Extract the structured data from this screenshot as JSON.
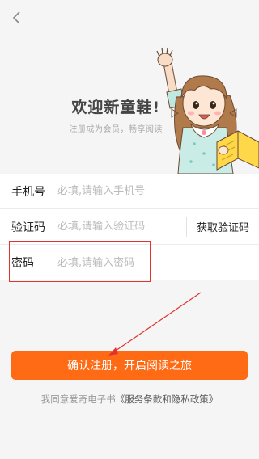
{
  "header": {
    "back_icon": "chevron-left-icon"
  },
  "hero": {
    "title": "欢迎新童鞋!",
    "subtitle": "注册成为会员，畅享阅读"
  },
  "form": {
    "phone": {
      "label": "手机号",
      "placeholder": "必填,请输入手机号",
      "value": ""
    },
    "code": {
      "label": "验证码",
      "placeholder": "必填,请输入验证码",
      "value": "",
      "get_code_label": "获取验证码"
    },
    "password": {
      "label": "密码",
      "placeholder": "必填,请输入密码",
      "value": ""
    }
  },
  "submit": {
    "label": "确认注册，开启阅读之旅"
  },
  "agreement": {
    "prefix": "我同意爱奇电子书",
    "link": "《服务条款和隐私政策》"
  },
  "colors": {
    "accent": "#ff6a14",
    "annotation": "#e0332d",
    "background": "#f5f5f5"
  }
}
